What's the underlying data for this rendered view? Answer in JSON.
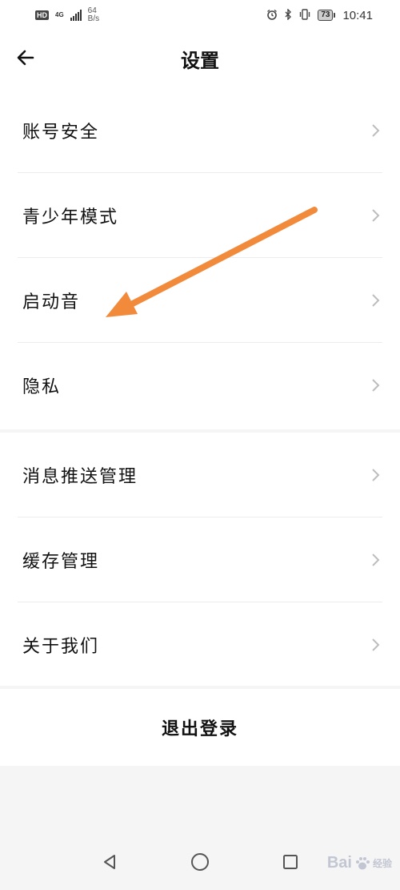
{
  "status_bar": {
    "hd": "HD",
    "network": "4G",
    "speed_value": "64",
    "speed_unit": "B/s",
    "battery": "73",
    "time": "10:41",
    "icons": [
      "alarm-icon",
      "bluetooth-icon",
      "vibrate-icon",
      "battery-icon"
    ]
  },
  "header": {
    "title": "设置",
    "back_icon": "back-arrow-icon"
  },
  "settings": {
    "group1": [
      {
        "label": "账号安全"
      },
      {
        "label": "青少年模式"
      },
      {
        "label": "启动音"
      },
      {
        "label": "隐私"
      }
    ],
    "group2": [
      {
        "label": "消息推送管理"
      },
      {
        "label": "缓存管理"
      },
      {
        "label": "关于我们"
      }
    ]
  },
  "logout": {
    "label": "退出登录"
  },
  "annotation": {
    "color": "#f28a3c",
    "icon": "annotation-arrow"
  },
  "nav": {
    "icons": [
      "back-triangle-icon",
      "home-circle-icon",
      "recents-square-icon"
    ]
  },
  "watermark": {
    "text": "Bai",
    "suffix": "经验"
  }
}
